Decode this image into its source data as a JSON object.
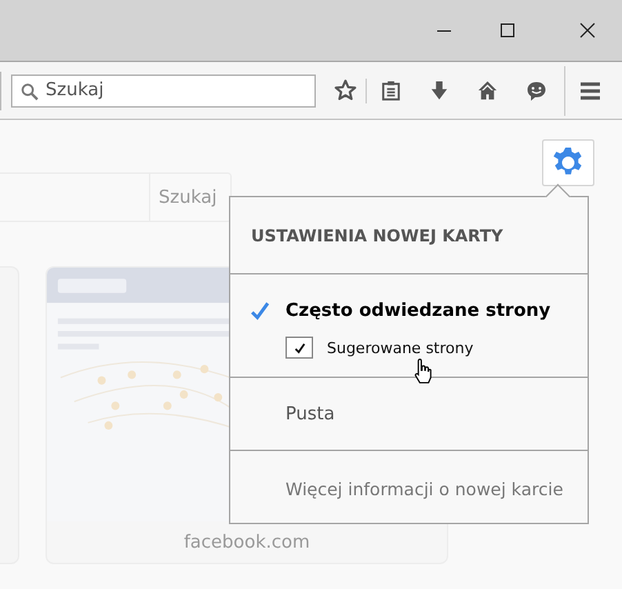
{
  "toolbar": {
    "search": {
      "placeholder": "Szukaj"
    }
  },
  "page": {
    "search_button": "Szukaj",
    "tiles": [
      {
        "kind": "cut"
      },
      {
        "kind": "picture",
        "label": "facebook.com"
      }
    ]
  },
  "settings_popup": {
    "title": "USTAWIENIA NOWEJ KARTY",
    "options": [
      {
        "label": "Często odwiedzane strony",
        "selected": true,
        "children": [
          {
            "label": "Sugerowane strony",
            "checked": true
          }
        ]
      },
      {
        "label": "Pusta",
        "selected": false
      }
    ],
    "link": "Więcej informacji o nowej karcie"
  }
}
